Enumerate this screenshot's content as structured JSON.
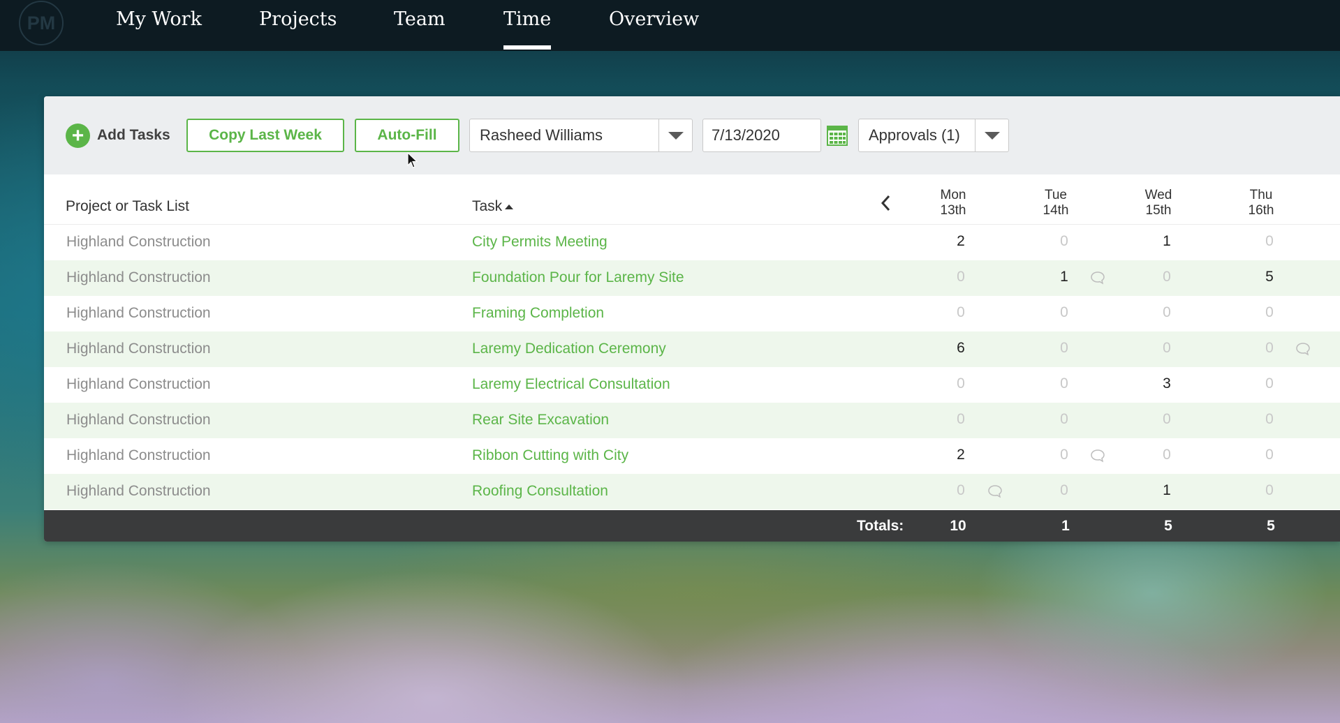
{
  "nav": {
    "logo": "PM",
    "items": [
      "My Work",
      "Projects",
      "Team",
      "Time",
      "Overview"
    ],
    "active": "Time"
  },
  "toolbar": {
    "add_tasks": "Add Tasks",
    "copy_last_week": "Copy Last Week",
    "auto_fill": "Auto-Fill",
    "user_select": "Rasheed Williams",
    "date": "7/13/2020",
    "approvals": "Approvals (1)"
  },
  "colors": {
    "accent": "#5bb548",
    "nav_bg": "#0d1b22",
    "totals_bg": "#3a3b3c",
    "alt_row": "#eef7ec"
  },
  "table": {
    "headers": {
      "project": "Project or Task List",
      "task": "Task",
      "days": [
        {
          "dow": "Mon",
          "date": "13th"
        },
        {
          "dow": "Tue",
          "date": "14th"
        },
        {
          "dow": "Wed",
          "date": "15th"
        },
        {
          "dow": "Thu",
          "date": "16th"
        }
      ]
    },
    "rows": [
      {
        "project": "Highland Construction",
        "task": "City Permits Meeting",
        "hours": [
          "2",
          "0",
          "1",
          "0"
        ],
        "comments": []
      },
      {
        "project": "Highland Construction",
        "task": "Foundation Pour for Laremy Site",
        "hours": [
          "0",
          "1",
          "0",
          "5"
        ],
        "comments": [
          1
        ]
      },
      {
        "project": "Highland Construction",
        "task": "Framing Completion",
        "hours": [
          "0",
          "0",
          "0",
          "0"
        ],
        "comments": []
      },
      {
        "project": "Highland Construction",
        "task": "Laremy Dedication Ceremony",
        "hours": [
          "6",
          "0",
          "0",
          "0"
        ],
        "comments": [
          3
        ]
      },
      {
        "project": "Highland Construction",
        "task": "Laremy Electrical Consultation",
        "hours": [
          "0",
          "0",
          "3",
          "0"
        ],
        "comments": []
      },
      {
        "project": "Highland Construction",
        "task": "Rear Site Excavation",
        "hours": [
          "0",
          "0",
          "0",
          "0"
        ],
        "comments": []
      },
      {
        "project": "Highland Construction",
        "task": "Ribbon Cutting with City",
        "hours": [
          "2",
          "0",
          "0",
          "0"
        ],
        "comments": [
          1
        ]
      },
      {
        "project": "Highland Construction",
        "task": "Roofing Consultation",
        "hours": [
          "0",
          "0",
          "1",
          "0"
        ],
        "comments": [
          0
        ]
      }
    ],
    "totals_label": "Totals:",
    "totals": [
      "10",
      "1",
      "5",
      "5"
    ]
  },
  "icons": [
    "logo",
    "plus-icon",
    "chevron-down-icon",
    "calendar-icon",
    "chevron-left-icon",
    "sort-ascending-icon",
    "comment-icon",
    "mouse-cursor-icon"
  ]
}
